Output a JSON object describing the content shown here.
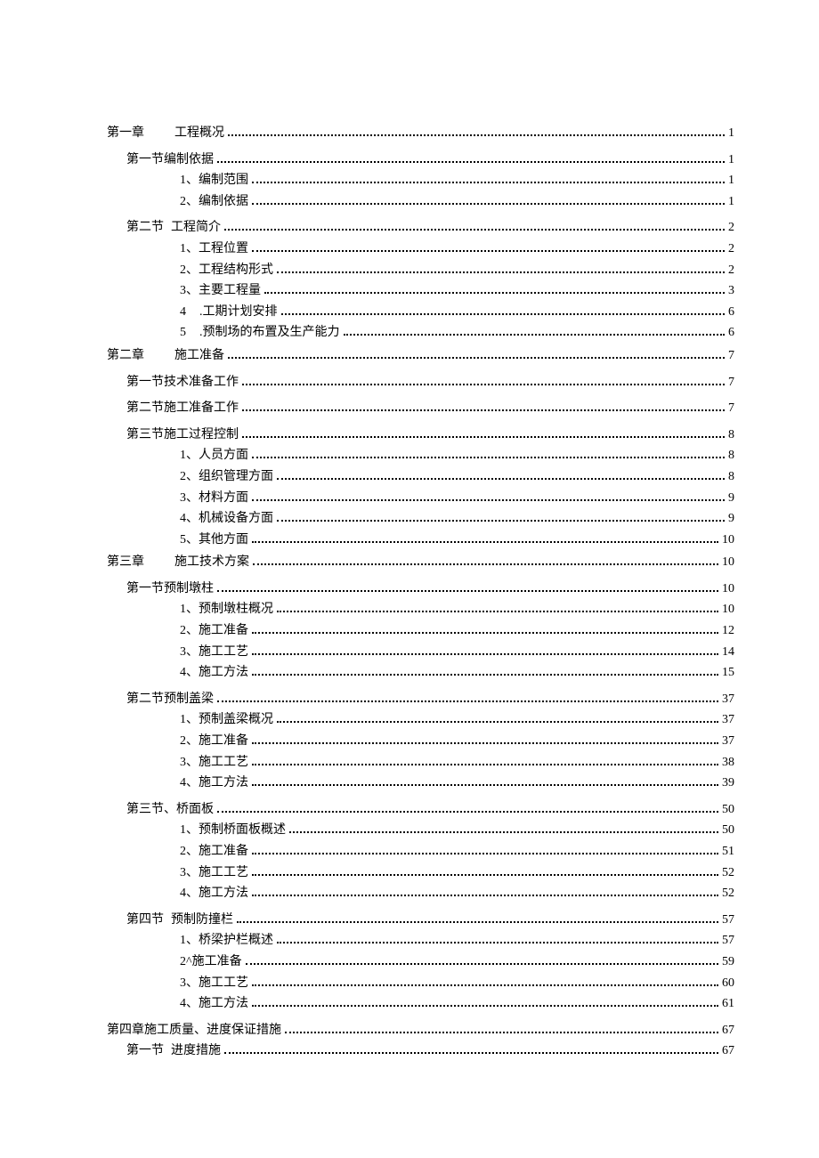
{
  "toc": [
    {
      "level": "ch",
      "prefix": "第一章",
      "title": "工程概况",
      "page": "1"
    },
    {
      "level": "sec",
      "prefix": "第一节",
      "title": "编制依据",
      "page": "1"
    },
    {
      "level": "sub",
      "prefix": "1、",
      "title": "编制范围",
      "page": "1",
      "tight": true
    },
    {
      "level": "sub",
      "prefix": "2、",
      "title": "编制依据",
      "page": "1",
      "tight": true
    },
    {
      "level": "sec-sp",
      "prefix": "第二节",
      "title": "工程简介",
      "page": "2"
    },
    {
      "level": "sub",
      "prefix": "1、",
      "title": "工程位置",
      "page": "2",
      "tight": true
    },
    {
      "level": "sub",
      "prefix": "2、",
      "title": "工程结构形式",
      "page": "2",
      "tight": true
    },
    {
      "level": "sub",
      "prefix": "3、",
      "title": "主要工程量",
      "page": "3",
      "tight": true
    },
    {
      "level": "sub",
      "prefix": "4",
      "title": ".工期计划安排",
      "page": "6",
      "tight": true,
      "numspace": true
    },
    {
      "level": "sub",
      "prefix": "5",
      "title": ".预制场的布置及生产能力",
      "page": "6",
      "tight": true,
      "numspace": true
    },
    {
      "level": "ch",
      "prefix": "第二章",
      "title": "施工准备",
      "page": "7"
    },
    {
      "level": "sec",
      "prefix": "第一节",
      "title": "技术准备工作",
      "page": "7"
    },
    {
      "level": "sec",
      "prefix": "第二节",
      "title": "施工准备工作",
      "page": "7"
    },
    {
      "level": "sec",
      "prefix": "第三节",
      "title": "施工过程控制",
      "page": "8"
    },
    {
      "level": "sub",
      "prefix": "1、",
      "title": "人员方面",
      "page": "8",
      "tight": true
    },
    {
      "level": "sub",
      "prefix": "2、",
      "title": "组织管理方面",
      "page": "8",
      "tight": true
    },
    {
      "level": "sub",
      "prefix": "3、",
      "title": "材料方面",
      "page": "9",
      "tight": true
    },
    {
      "level": "sub",
      "prefix": "4、",
      "title": "机械设备方面",
      "page": "9",
      "tight": true
    },
    {
      "level": "sub",
      "prefix": "5、",
      "title": "其他方面",
      "page": "10",
      "tight": true
    },
    {
      "level": "ch",
      "prefix": "第三章",
      "title": "施工技术方案",
      "page": "10"
    },
    {
      "level": "sec",
      "prefix": "第一节",
      "title": "预制墩柱",
      "page": "10"
    },
    {
      "level": "sub",
      "prefix": "1、",
      "title": "预制墩柱概况",
      "page": "10",
      "tight": true
    },
    {
      "level": "sub",
      "prefix": "2、",
      "title": "施工准备",
      "page": "12",
      "tight": true
    },
    {
      "level": "sub",
      "prefix": "3、",
      "title": "施工工艺",
      "page": "14",
      "tight": true
    },
    {
      "level": "sub",
      "prefix": "4、",
      "title": "施工方法",
      "page": "15",
      "tight": true
    },
    {
      "level": "sec",
      "prefix": "第二节",
      "title": "预制盖梁",
      "page": "37"
    },
    {
      "level": "sub",
      "prefix": "1、",
      "title": "预制盖梁概况",
      "page": "37",
      "tight": true
    },
    {
      "level": "sub",
      "prefix": "2、",
      "title": "施工准备",
      "page": "37",
      "tight": true
    },
    {
      "level": "sub",
      "prefix": "3、",
      "title": "施工工艺",
      "page": "38",
      "tight": true
    },
    {
      "level": "sub",
      "prefix": "4、",
      "title": "施工方法",
      "page": "39",
      "tight": true
    },
    {
      "level": "sec",
      "prefix": "第三节、",
      "title": "桥面板",
      "page": "50"
    },
    {
      "level": "sub",
      "prefix": "1、",
      "title": "预制桥面板概述",
      "page": "50",
      "tight": true
    },
    {
      "level": "sub",
      "prefix": "2、",
      "title": "施工准备",
      "page": "51",
      "tight": true
    },
    {
      "level": "sub",
      "prefix": "3、",
      "title": "施工工艺",
      "page": "52",
      "tight": true
    },
    {
      "level": "sub",
      "prefix": "4、",
      "title": "施工方法",
      "page": "52",
      "tight": true
    },
    {
      "level": "sec-sp",
      "prefix": "第四节",
      "title": "预制防撞栏",
      "page": "57"
    },
    {
      "level": "sub",
      "prefix": "1、",
      "title": "桥梁护栏概述",
      "page": "57",
      "tight": true
    },
    {
      "level": "sub",
      "prefix": "2^",
      "title": "施工准备",
      "page": "59",
      "tight": true
    },
    {
      "level": "sub",
      "prefix": "3、",
      "title": "施工工艺",
      "page": "60",
      "tight": true
    },
    {
      "level": "sub",
      "prefix": "4、",
      "title": "施工方法",
      "page": "61",
      "tight": true
    },
    {
      "level": "ch-n",
      "prefix": "第四章",
      "title": "施工质量、进度保证措施",
      "page": "67"
    },
    {
      "level": "sec-sp",
      "prefix": "第一节",
      "title": "进度措施",
      "page": "67",
      "tight": true
    }
  ]
}
